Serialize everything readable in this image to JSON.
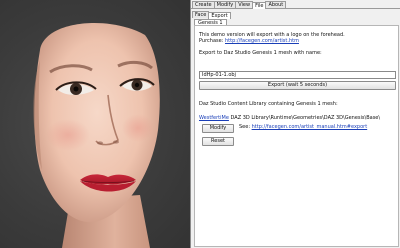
{
  "main_tabs": [
    "Create",
    "Modify",
    "View",
    "File",
    "About"
  ],
  "active_main_tab": "File",
  "sub_tabs": [
    "Face",
    "Export"
  ],
  "active_sub_tab": "Export",
  "section_tab": "Genesis 1",
  "demo_notice": "This demo version will export with a logo on the forehead.",
  "purchase": {
    "label": "Purchase:",
    "link": "http://facegen.com/artist.htm"
  },
  "export_label": "Export to Daz Studio Genesis 1 mesh with name:",
  "export_filename": "IdHp-01-1.obj",
  "export_button": "Export (wait 5 seconds)",
  "library_label": "Daz Studio Content Library containing Genesis 1 mesh:",
  "library_path_link": "WestfertiMe",
  "library_path_rest": " DAZ 3D Library\\Runtime\\Geometries\\DAZ 3D\\Genesis\\Base\\",
  "modify_button": "Modify",
  "see_label": "See:",
  "see_link": "http://facegen.com/artist_manual.htm#export",
  "reset_button": "Reset",
  "colors": {
    "viewport_bg": "#3b3b3b",
    "panel_bg": "#f0f0f0",
    "link": "#1a3fb8"
  }
}
